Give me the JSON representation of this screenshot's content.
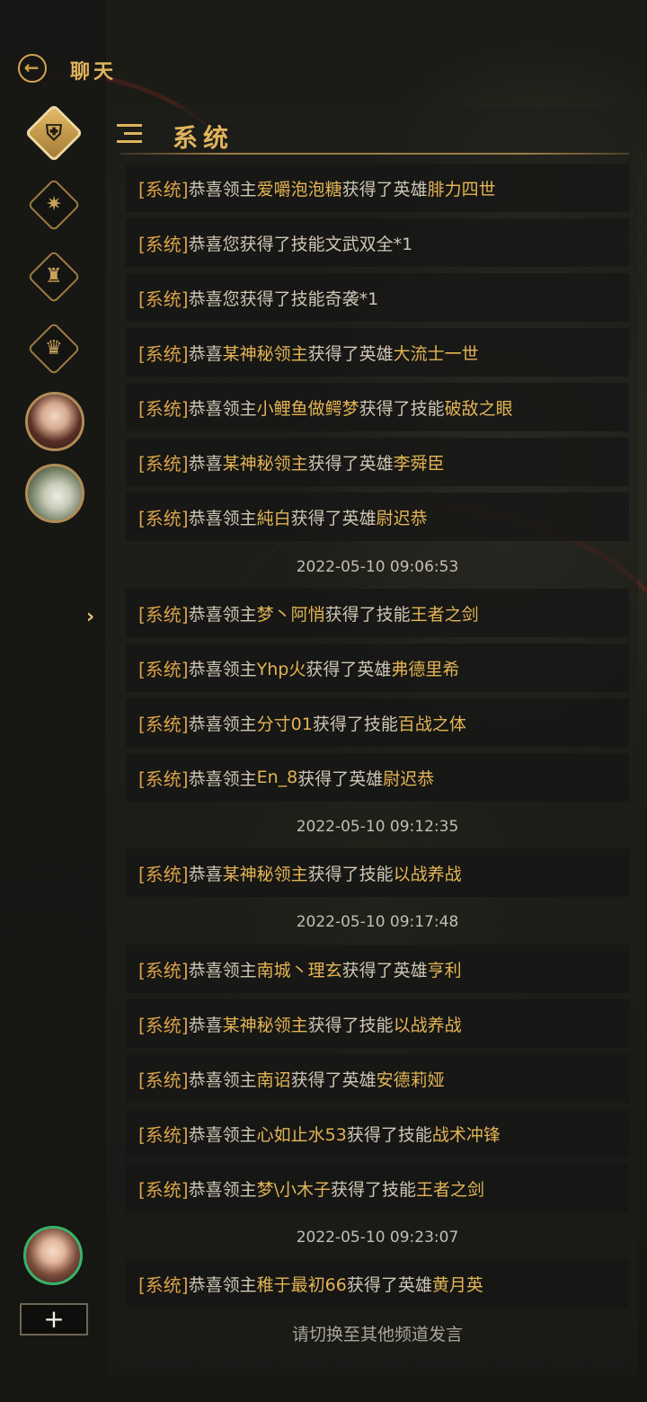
{
  "header": {
    "back_icon": "back-arrow-icon",
    "title": "聊天"
  },
  "channel": {
    "menu_icon": "menu-collapse-icon",
    "title": "系统"
  },
  "rail": [
    {
      "name": "guild-icon",
      "glyph": "⛨",
      "active": true
    },
    {
      "name": "compass-icon",
      "glyph": "✷",
      "active": false
    },
    {
      "name": "castle-icon",
      "glyph": "♜",
      "active": false
    },
    {
      "name": "crest-icon",
      "glyph": "♛",
      "active": false
    }
  ],
  "rail_expand_icon": "›",
  "add_button": "+",
  "messages": [
    {
      "tag": "[系统]",
      "pre": "恭喜领主",
      "name": "爱嚼泡泡糖",
      "mid": "获得了英雄",
      "reward": "腓力四世"
    },
    {
      "tag": "[系统]",
      "pre": "恭喜您获得了技能文武双全*1",
      "name": "",
      "mid": "",
      "reward": ""
    },
    {
      "tag": "[系统]",
      "pre": "恭喜您获得了技能奇袭*1",
      "name": "",
      "mid": "",
      "reward": ""
    },
    {
      "tag": "[系统]",
      "pre": "恭喜",
      "name": "某神秘领主",
      "mid": "获得了英雄",
      "reward": "大流士一世"
    },
    {
      "tag": "[系统]",
      "pre": "恭喜领主",
      "name": "小鲤鱼做鳄梦",
      "mid": "获得了技能",
      "reward": "破敌之眼"
    },
    {
      "tag": "[系统]",
      "pre": "恭喜",
      "name": "某神秘领主",
      "mid": "获得了英雄",
      "reward": "李舜臣"
    },
    {
      "tag": "[系统]",
      "pre": "恭喜领主",
      "name": "純白",
      "mid": "获得了英雄",
      "reward": "尉迟恭"
    },
    {
      "time": "2022-05-10 09:06:53"
    },
    {
      "tag": "[系统]",
      "pre": "恭喜领主",
      "name": "梦丶阿悄",
      "mid": "获得了技能",
      "reward": "王者之剑"
    },
    {
      "tag": "[系统]",
      "pre": "恭喜领主",
      "name": "Yhp火",
      "mid": "获得了英雄",
      "reward": "弗德里希"
    },
    {
      "tag": "[系统]",
      "pre": "恭喜领主",
      "name": "分寸01",
      "mid": "获得了技能",
      "reward": "百战之体"
    },
    {
      "tag": "[系统]",
      "pre": "恭喜领主",
      "name": "En_8",
      "mid": "获得了英雄",
      "reward": "尉迟恭"
    },
    {
      "time": "2022-05-10 09:12:35"
    },
    {
      "tag": "[系统]",
      "pre": "恭喜",
      "name": "某神秘领主",
      "mid": "获得了技能",
      "reward": "以战养战"
    },
    {
      "time": "2022-05-10 09:17:48"
    },
    {
      "tag": "[系统]",
      "pre": "恭喜领主",
      "name": "南城丶理玄",
      "mid": "获得了英雄",
      "reward": "亨利"
    },
    {
      "tag": "[系统]",
      "pre": "恭喜",
      "name": "某神秘领主",
      "mid": "获得了技能",
      "reward": "以战养战"
    },
    {
      "tag": "[系统]",
      "pre": "恭喜领主",
      "name": "南诏",
      "mid": "获得了英雄",
      "reward": "安德莉娅"
    },
    {
      "tag": "[系统]",
      "pre": "恭喜领主",
      "name": "心如止水53",
      "mid": "获得了技能",
      "reward": "战术冲锋"
    },
    {
      "tag": "[系统]",
      "pre": "恭喜领主",
      "name": "梦\\小木子",
      "mid": "获得了技能",
      "reward": "王者之剑"
    },
    {
      "time": "2022-05-10 09:23:07"
    },
    {
      "tag": "[系统]",
      "pre": "恭喜领主",
      "name": "稚于最初66",
      "mid": "获得了英雄",
      "reward": "黄月英"
    }
  ],
  "notice": "请切换至其他频道发言"
}
